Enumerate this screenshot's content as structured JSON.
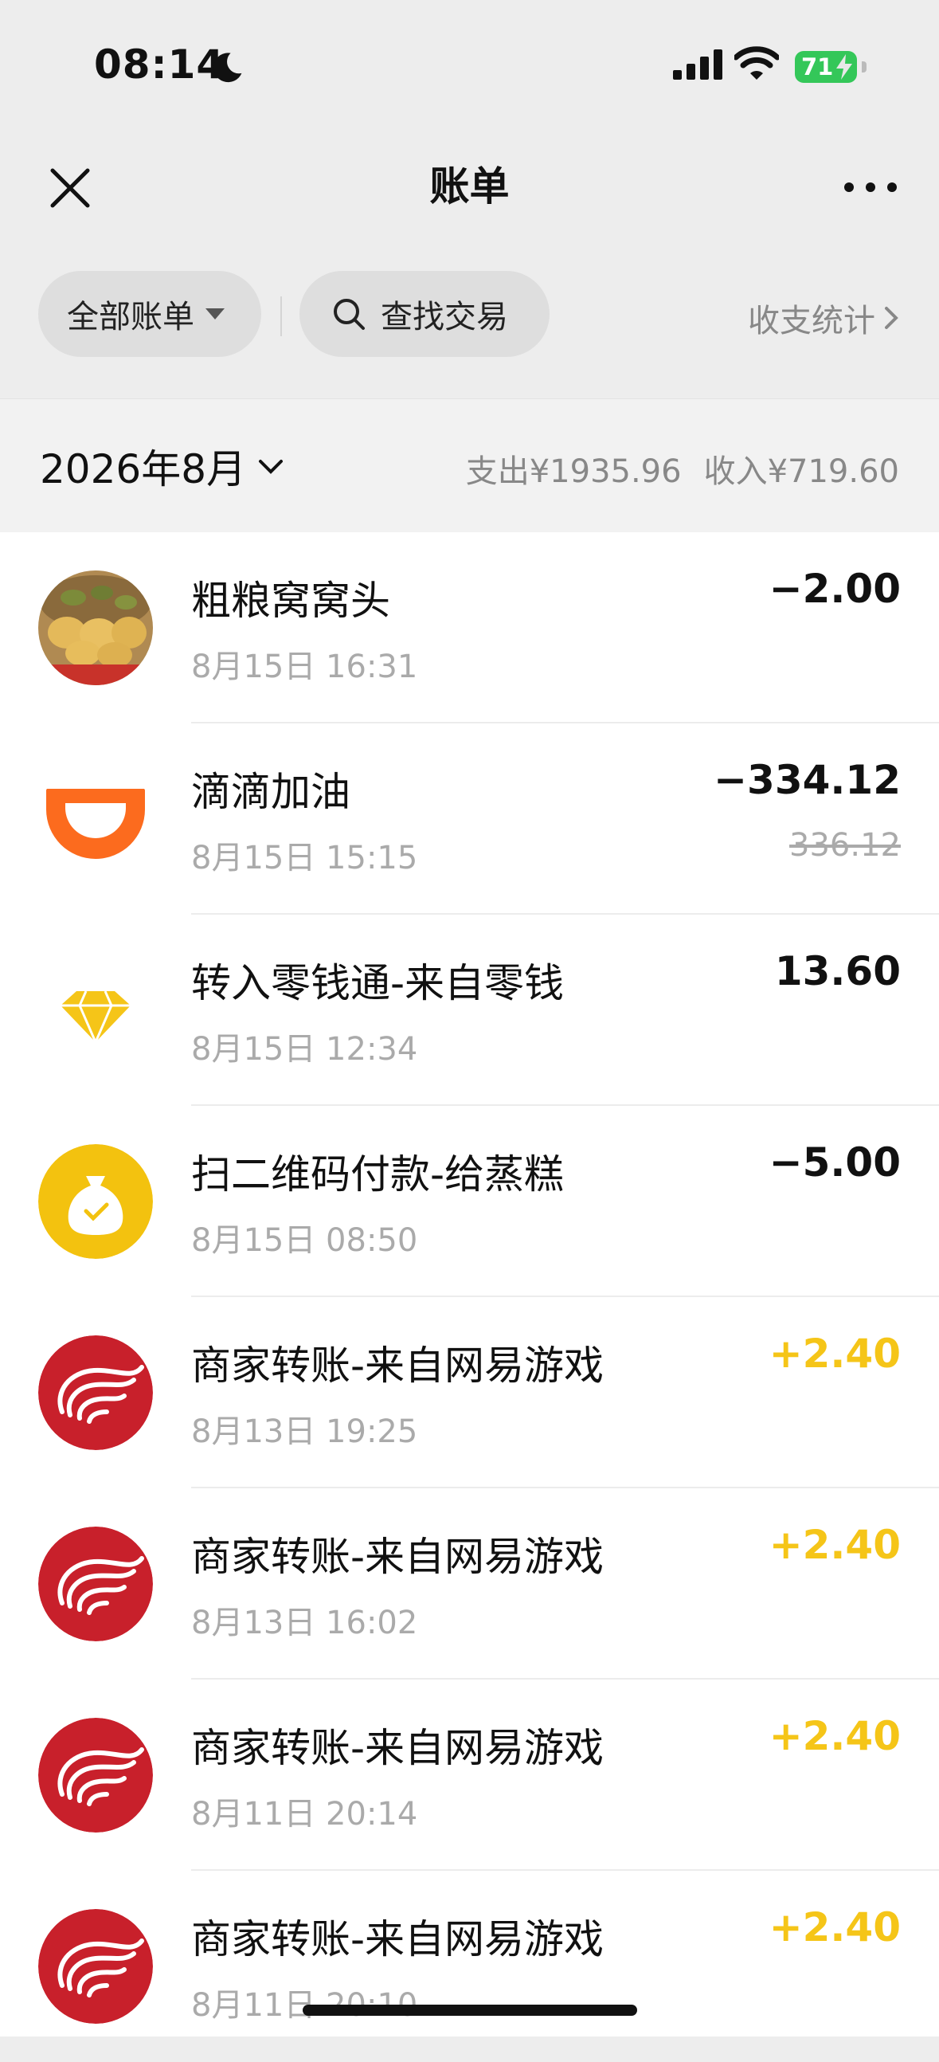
{
  "status_bar": {
    "time": "08:14",
    "battery": "71"
  },
  "nav": {
    "title": "账单"
  },
  "filters": {
    "all_bills_label": "全部账单",
    "search_label": "查找交易",
    "stats_label": "收支统计"
  },
  "month_bar": {
    "month": "2026年8月",
    "expense": "支出¥1935.96",
    "income": "收入¥719.60"
  },
  "transactions": [
    {
      "title": "粗粮窝窝头",
      "time": "8月15日 16:31",
      "amount": "−2.00",
      "icon": "food-photo-icon"
    },
    {
      "title": "滴滴加油",
      "time": "8月15日 15:15",
      "amount": "−334.12",
      "original_amount": "336.12",
      "icon": "didi-logo-icon"
    },
    {
      "title": "转入零钱通-来自零钱",
      "time": "8月15日 12:34",
      "amount": "13.60",
      "icon": "diamond-icon"
    },
    {
      "title": "扫二维码付款-给蒸糕",
      "time": "8月15日 08:50",
      "amount": "−5.00",
      "icon": "money-bag-icon"
    },
    {
      "title": "商家转账-来自网易游戏",
      "time": "8月13日 19:25",
      "amount": "+2.40",
      "icon": "netease-logo-icon"
    },
    {
      "title": "商家转账-来自网易游戏",
      "time": "8月13日 16:02",
      "amount": "+2.40",
      "icon": "netease-logo-icon"
    },
    {
      "title": "商家转账-来自网易游戏",
      "time": "8月11日 20:14",
      "amount": "+2.40",
      "icon": "netease-logo-icon"
    },
    {
      "title": "商家转账-来自网易游戏",
      "time": "8月11日 20:10",
      "amount": "+2.40",
      "icon": "netease-logo-icon"
    }
  ],
  "colors": {
    "income": "#f5c518",
    "didi_orange": "#fc6b1e",
    "netease_red": "#c8202b",
    "bag_yellow": "#f3c20f",
    "battery_green": "#34c759"
  }
}
